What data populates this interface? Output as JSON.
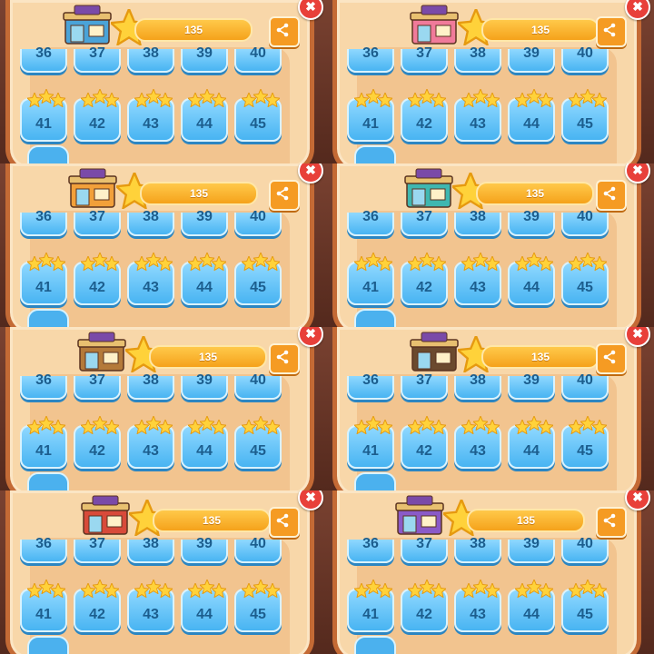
{
  "ui": {
    "colors": {
      "panel": "#f8d7a9",
      "border": "#c46a35",
      "tile": "#48b4f2",
      "gold": "#f5a21b",
      "close": "#e8403a"
    },
    "icons": {
      "close": "close-icon",
      "share": "share-icon",
      "star": "star-icon",
      "shop": "shop-building-icon"
    }
  },
  "screens": [
    {
      "score": "135",
      "top_row": [
        "36",
        "37",
        "38",
        "39",
        "40"
      ],
      "bottom_row": [
        "41",
        "42",
        "43",
        "44",
        "45"
      ],
      "stars_per_level": 3
    },
    {
      "score": "135",
      "top_row": [
        "36",
        "37",
        "38",
        "39",
        "40"
      ],
      "bottom_row": [
        "41",
        "42",
        "43",
        "44",
        "45"
      ],
      "stars_per_level": 3
    },
    {
      "score": "135",
      "top_row": [
        "36",
        "37",
        "38",
        "39",
        "40"
      ],
      "bottom_row": [
        "41",
        "42",
        "43",
        "44",
        "45"
      ],
      "stars_per_level": 3
    },
    {
      "score": "135",
      "top_row": [
        "36",
        "37",
        "38",
        "39",
        "40"
      ],
      "bottom_row": [
        "41",
        "42",
        "43",
        "44",
        "45"
      ],
      "stars_per_level": 3
    },
    {
      "score": "135",
      "top_row": [
        "36",
        "37",
        "38",
        "39",
        "40"
      ],
      "bottom_row": [
        "41",
        "42",
        "43",
        "44",
        "45"
      ],
      "stars_per_level": 3
    },
    {
      "score": "135",
      "top_row": [
        "36",
        "37",
        "38",
        "39",
        "40"
      ],
      "bottom_row": [
        "41",
        "42",
        "43",
        "44",
        "45"
      ],
      "stars_per_level": 3
    },
    {
      "score": "135",
      "top_row": [
        "36",
        "37",
        "38",
        "39",
        "40"
      ],
      "bottom_row": [
        "41",
        "42",
        "43",
        "44",
        "45"
      ],
      "stars_per_level": 3
    },
    {
      "score": "135",
      "top_row": [
        "36",
        "37",
        "38",
        "39",
        "40"
      ],
      "bottom_row": [
        "41",
        "42",
        "43",
        "44",
        "45"
      ],
      "stars_per_level": 3
    }
  ]
}
